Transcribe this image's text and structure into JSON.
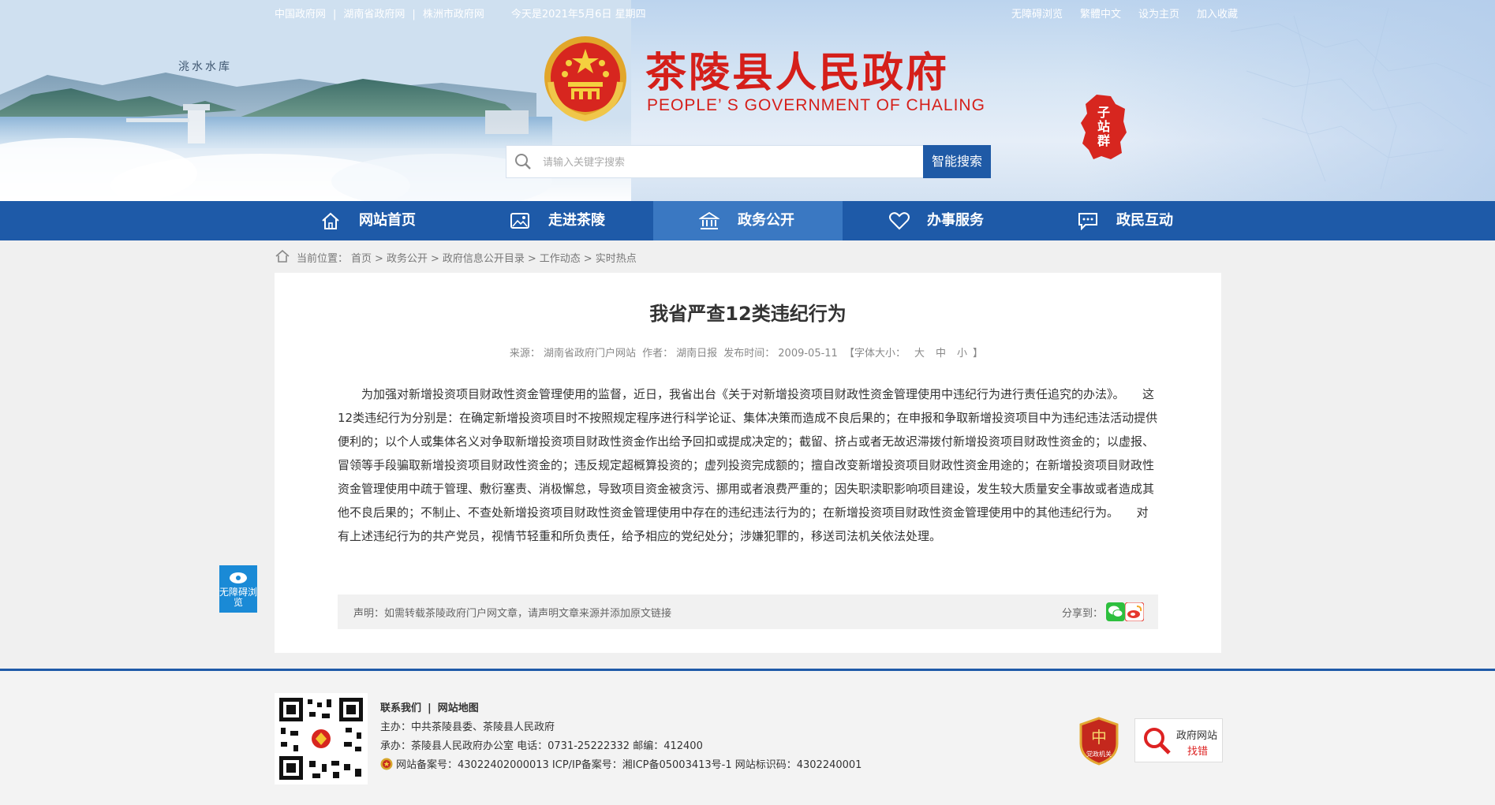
{
  "topbar": {
    "links_left": [
      "中国政府网",
      "湖南省政府网",
      "株洲市政府网"
    ],
    "separator": "|",
    "date": "今天是2021年5月6日 星期四",
    "links_right": [
      "无障碍浏览",
      "繁體中文",
      "设为主页",
      "加入收藏"
    ]
  },
  "banner": {
    "lake_label": "洮水水库",
    "title": "茶陵县人民政府",
    "subtitle": "PEOPLE’ S GOVERNMENT OF CHALING",
    "subsite_label": "子站群",
    "colors": {
      "title_red": "#d51f1a",
      "nav_blue": "#1e5aa8",
      "nav_active": "#3a78c2"
    }
  },
  "search": {
    "placeholder": "请输入关键字搜索",
    "button": "智能搜索"
  },
  "nav": {
    "items": [
      {
        "label": "网站首页",
        "icon": "home-icon"
      },
      {
        "label": "走进茶陵",
        "icon": "picture-icon"
      },
      {
        "label": "政务公开",
        "icon": "government-building-icon",
        "active": true
      },
      {
        "label": "办事服务",
        "icon": "heart-icon"
      },
      {
        "label": "政民互动",
        "icon": "chat-bubble-icon"
      }
    ]
  },
  "breadcrumb": {
    "prefix": "当前位置：",
    "items": [
      "首页",
      "政务公开",
      "政府信息公开目录",
      "工作动态",
      "实时热点"
    ],
    "separator": ">"
  },
  "article": {
    "title": "我省严查12类违纪行为",
    "meta": {
      "source_label": "来源：",
      "source": "湖南省政府门户网站",
      "author_label": "作者：",
      "author": "湖南日报",
      "time_label": "发布时间：",
      "time": "2009-05-11",
      "size_label": "【字体大小：",
      "size_large": "大",
      "size_medium": "中",
      "size_small": "小",
      "size_end": "】"
    },
    "body": "　　为加强对新增投资项目财政性资金管理使用的监督，近日，我省出台《关于对新增投资项目财政性资金管理使用中违纪行为进行责任追究的办法》。　　这12类违纪行为分别是：在确定新增投资项目时不按照规定程序进行科学论证、集体决策而造成不良后果的；在申报和争取新增投资项目中为违纪违法活动提供便利的；以个人或集体名义对争取新增投资项目财政性资金作出给予回扣或提成决定的；截留、挤占或者无故迟滞拨付新增投资项目财政性资金的；以虚报、冒领等手段骗取新增投资项目财政性资金的；违反规定超概算投资的；虚列投资完成额的；擅自改变新增投资项目财政性资金用途的；在新增投资项目财政性资金管理使用中疏于管理、敷衍塞责、消极懈怠，导致项目资金被贪污、挪用或者浪费严重的；因失职渎职影响项目建设，发生较大质量安全事故或者造成其他不良后果的；不制止、不查处新增投资项目财政性资金管理使用中存在的违纪违法行为的；在新增投资项目财政性资金管理使用中的其他违纪行为。　　对有上述违纪行为的共产党员，视情节轻重和所负责任，给予相应的党纪处分；涉嫌犯罪的，移送司法机关依法处理。",
    "statement": "声明：如需转载茶陵政府门户网文章，请声明文章来源并添加原文链接",
    "share_label": "分享到："
  },
  "side": {
    "accessibility": "无障碍浏览"
  },
  "footer": {
    "links": [
      "联系我们",
      "网站地图"
    ],
    "sponsor": "主办：中共茶陵县委、茶陵县人民政府",
    "organizer": "承办：茶陵县人民政府办公室 电话：0731-25222332 邮编：412400",
    "record": "网站备案号：43022402000013 ICP/IP备案号：湘ICP备05003413号-1 网站标识码：4302240001",
    "party_badge": "党政机关",
    "error_title": "政府网站",
    "error_action": "找错"
  }
}
